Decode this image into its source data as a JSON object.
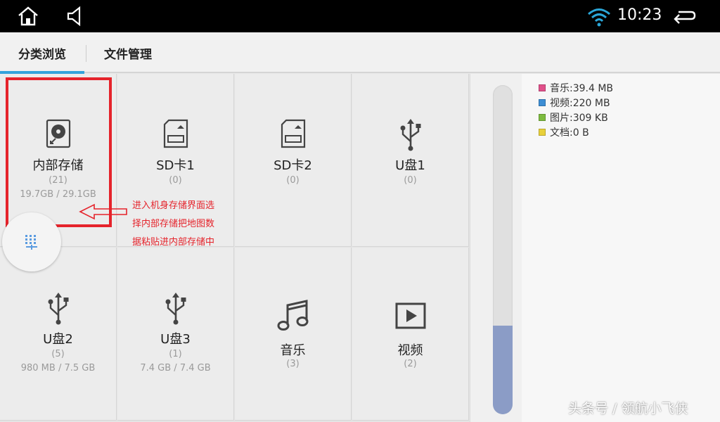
{
  "status_bar": {
    "time": "10:23",
    "icons": [
      "home-icon",
      "volume-icon",
      "wifi-icon",
      "back-icon"
    ]
  },
  "tabs": [
    {
      "label": "分类浏览",
      "active": true
    },
    {
      "label": "文件管理",
      "active": false
    }
  ],
  "grid": [
    {
      "name": "内部存储",
      "count": "(21)",
      "size": "19.7GB / 29.1GB",
      "icon": "hard-disk-icon"
    },
    {
      "name": "SD卡1",
      "count": "(0)",
      "size": "",
      "icon": "sd-card-icon"
    },
    {
      "name": "SD卡2",
      "count": "(0)",
      "size": "",
      "icon": "sd-card-icon"
    },
    {
      "name": "U盘1",
      "count": "(0)",
      "size": "",
      "icon": "usb-icon"
    },
    {
      "name": "U盘2",
      "count": "(5)",
      "size": "980 MB / 7.5 GB",
      "icon": "usb-icon"
    },
    {
      "name": "U盘3",
      "count": "(1)",
      "size": "7.4 GB / 7.4 GB",
      "icon": "usb-icon"
    },
    {
      "name": "音乐",
      "count": "(3)",
      "size": "",
      "icon": "music-icon"
    },
    {
      "name": "视频",
      "count": "(2)",
      "size": "",
      "icon": "video-icon"
    }
  ],
  "annotation": {
    "lines": [
      "进入机身存储界面选",
      "择内部存储把地图数",
      "据粘贴进内部存储中"
    ]
  },
  "chart_data": {
    "type": "bar",
    "categories": [
      "音乐",
      "视频",
      "图片",
      "文档"
    ],
    "legend": [
      {
        "label": "音乐:39.4 MB",
        "color": "#e0508a"
      },
      {
        "label": "视频:220 MB",
        "color": "#3d8ed4"
      },
      {
        "label": "图片:309 KB",
        "color": "#7dbb3f"
      },
      {
        "label": "文档:0 B",
        "color": "#e8d03a"
      }
    ],
    "used_fraction": 0.27,
    "fill_color": "#8b9cc6"
  },
  "watermark": "头条号 / 领航小飞侠"
}
